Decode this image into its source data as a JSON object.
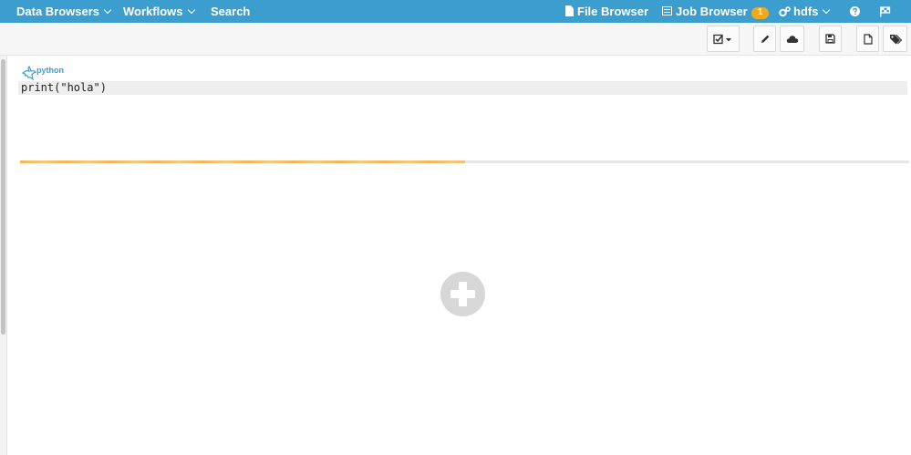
{
  "nav": {
    "data_browsers": "Data Browsers",
    "workflows": "Workflows",
    "search": "Search",
    "file_browser": "File Browser",
    "job_browser": "Job Browser",
    "job_count": "1",
    "user": "hdfs"
  },
  "toolbar": {
    "icons": [
      "checkbox-dropdown-icon",
      "pencil-icon",
      "cloud-icon",
      "save-icon",
      "new-document-icon",
      "tags-icon"
    ]
  },
  "snippet": {
    "language": "python",
    "code": "print(\"hola\")"
  },
  "progress": {
    "percent": 50
  },
  "colors": {
    "nav_bg": "#3c9ecf",
    "badge": "#f0a81f",
    "progress": "#f2b55a",
    "add_button": "#d7d7d7"
  }
}
